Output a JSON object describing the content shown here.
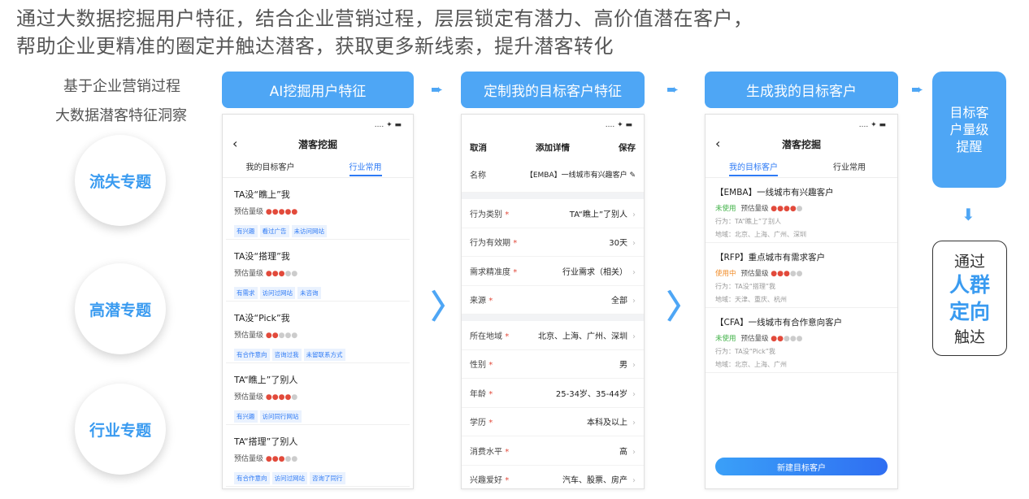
{
  "headline": {
    "line1": "通过大数据挖掘用户特征，结合企业营销过程，层层锁定有潜力、高价值潜在客户，",
    "line2": "帮助企业更精准的圈定并触达潜客，获取更多新线索，提升潜客转化"
  },
  "side": {
    "line1": "基于企业营销过程",
    "line2": "大数据潜客特征洞察",
    "bubbles": [
      "流失专题",
      "高潜专题",
      "行业专题"
    ]
  },
  "steps": [
    "AI挖掘用户特征",
    "定制我的目标客户特征",
    "生成我的目标客户"
  ],
  "arrow_glyph": "➨",
  "chevron_glyph": "〉",
  "phone1": {
    "status": "....  ✦ ▬",
    "title": "潜客挖掘",
    "back": "‹",
    "tabs": [
      "我的目标客户",
      "行业常用"
    ],
    "grade_label": "预估量级",
    "cards": [
      {
        "title": "TA没“瞧上”我",
        "level": 5,
        "tags": [
          "有兴趣",
          "看过广告",
          "未访问网站"
        ]
      },
      {
        "title": "TA没“搭理”我",
        "level": 3,
        "tags": [
          "有需求",
          "访问过网站",
          "未咨询"
        ]
      },
      {
        "title": "TA没“Pick”我",
        "level": 2,
        "tags": [
          "有合作意向",
          "咨询过我",
          "未留联系方式"
        ]
      },
      {
        "title": "TA“瞧上”了别人",
        "level": 4,
        "tags": [
          "有兴趣",
          "访问同行网站"
        ]
      },
      {
        "title": "TA“搭理”了别人",
        "level": 3,
        "tags": [
          "有合作意向",
          "访问过网站",
          "咨询了同行"
        ]
      }
    ]
  },
  "phone2": {
    "status": "....  ✦ ▬",
    "cancel": "取消",
    "title": "添加详情",
    "save": "保存",
    "name_key": "名称",
    "name_val": "【EMBA】一线城市有兴趣客户 ✎",
    "group1": [
      {
        "k": "行为类别",
        "v": "TA“瞧上”了别人"
      },
      {
        "k": "行为有效期",
        "v": "30天"
      },
      {
        "k": "需求精准度",
        "v": "行业需求（相关）"
      },
      {
        "k": "来源",
        "v": "全部"
      }
    ],
    "group2": [
      {
        "k": "所在地域",
        "v": "北京、上海、广州、深圳"
      },
      {
        "k": "性别",
        "v": "男"
      },
      {
        "k": "年龄",
        "v": "25-34岁、35-44岁"
      },
      {
        "k": "学历",
        "v": "本科及以上"
      },
      {
        "k": "消费水平",
        "v": "高"
      },
      {
        "k": "兴趣爱好",
        "v": "汽车、股票、房产"
      }
    ]
  },
  "phone3": {
    "status": "....  ✦ ▬",
    "title": "潜客挖掘",
    "back": "‹",
    "tabs": [
      "我的目标客户",
      "行业常用"
    ],
    "grade_label": "预估量级",
    "cards": [
      {
        "title": "【EMBA】一线城市有兴趣客户",
        "status": "未使用",
        "status_color": "#3cb043",
        "level": 4,
        "meta1": "行为：TA“瞧上”了别人",
        "meta2": "地域：北京、上海、广州、深圳"
      },
      {
        "title": "【RFP】重点城市有需求客户",
        "status": "使用中",
        "status_color": "#f08a24",
        "level": 3,
        "meta1": "行为：TA没“搭理”我",
        "meta2": "地域：天津、重庆、杭州"
      },
      {
        "title": "【CFA】一线城市有合作意向客户",
        "status": "未使用",
        "status_color": "#3cb043",
        "level": 2,
        "meta1": "行为：TA没“Pick”我",
        "meta2": "地域：北京、上海、广州"
      }
    ],
    "button": "新建目标客户"
  },
  "remind": [
    "目标客",
    "户量级",
    "提醒"
  ],
  "down_glyph": "⬇",
  "reach": {
    "a": "通过",
    "b1": "人群",
    "b2": "定向",
    "c": "触达"
  },
  "colors": {
    "accent": "#4ea6f5",
    "link": "#2f7bf5",
    "drop": "#e24a3b"
  }
}
